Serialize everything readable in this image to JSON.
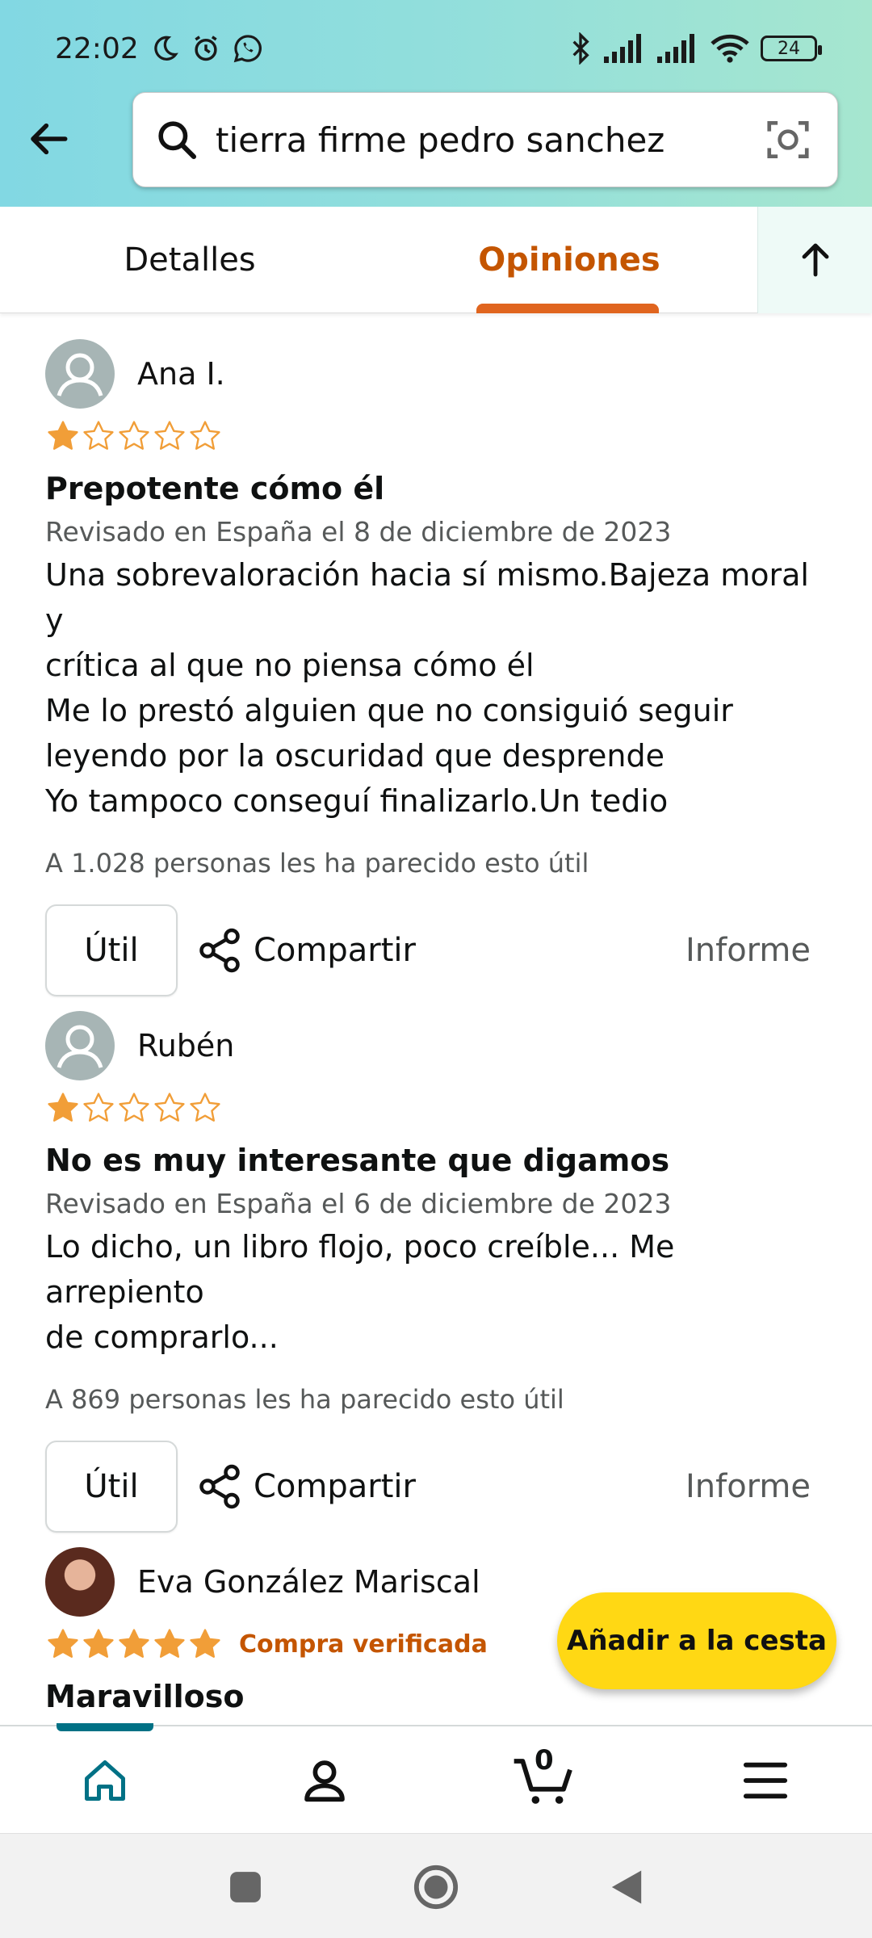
{
  "status_bar": {
    "time": "22:02",
    "battery": "24"
  },
  "search": {
    "query": "tierra firme pedro sanchez"
  },
  "tabs": [
    {
      "label": "Detalles",
      "active": false
    },
    {
      "label": "Opiniones",
      "active": true
    }
  ],
  "reviews": [
    {
      "reviewer": "Ana I.",
      "rating": 1,
      "title": "Prepotente cómo él",
      "date": "Revisado en España el 8 de diciembre de 2023",
      "body_lines": [
        "Una sobrevaloración hacia sí mismo.Bajeza moral y",
        "crítica al que no piensa cómo él",
        "Me lo prestó alguien que no consiguió seguir",
        "leyendo por la oscuridad que desprende",
        "Yo tampoco conseguí finalizarlo.Un tedio"
      ],
      "helpful": "A 1.028 personas les ha parecido esto útil",
      "helpful_button": "Útil",
      "share_label": "Compartir",
      "report_label": "Informe"
    },
    {
      "reviewer": "Rubén",
      "rating": 1,
      "title": "No es muy interesante que digamos",
      "date": "Revisado en España el 6 de diciembre de 2023",
      "body_lines": [
        "Lo dicho, un libro flojo, poco creíble... Me arrepiento",
        "de comprarlo..."
      ],
      "helpful": "A 869 personas les ha parecido esto útil",
      "helpful_button": "Útil",
      "share_label": "Compartir",
      "report_label": "Informe"
    },
    {
      "reviewer": "Eva González Mariscal",
      "rating": 5,
      "verified": "Compra verificada",
      "title": "Maravilloso"
    }
  ],
  "add_to_cart": "Añadir a la cesta",
  "bottom_nav": {
    "cart_count": "0"
  },
  "colors": {
    "accent_orange": "#c45500",
    "star": "#f19e38",
    "button_yellow": "#ffd814",
    "teal": "#007185"
  }
}
